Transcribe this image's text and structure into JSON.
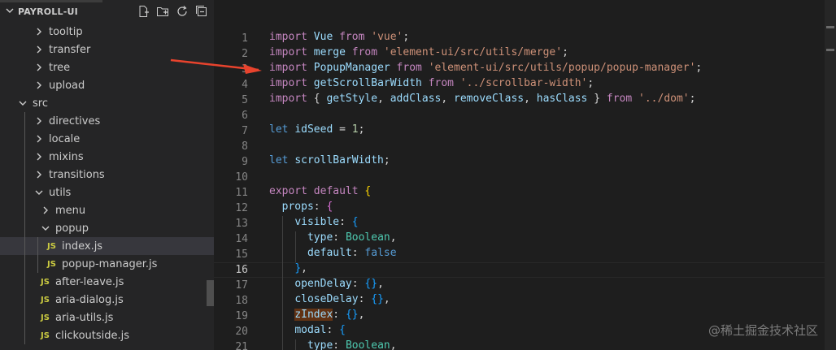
{
  "explorer": {
    "title": "PAYROLL-UI",
    "actions": [
      {
        "name": "new-file-icon"
      },
      {
        "name": "new-folder-icon"
      },
      {
        "name": "refresh-icon"
      },
      {
        "name": "collapse-all-icon"
      }
    ],
    "items": [
      {
        "label": "tooltip",
        "kind": "folder",
        "expanded": false,
        "depth": 2
      },
      {
        "label": "transfer",
        "kind": "folder",
        "expanded": false,
        "depth": 2
      },
      {
        "label": "tree",
        "kind": "folder",
        "expanded": false,
        "depth": 2
      },
      {
        "label": "upload",
        "kind": "folder",
        "expanded": false,
        "depth": 2
      },
      {
        "label": "src",
        "kind": "folder",
        "expanded": true,
        "depth": 1
      },
      {
        "label": "directives",
        "kind": "folder",
        "expanded": false,
        "depth": 2
      },
      {
        "label": "locale",
        "kind": "folder",
        "expanded": false,
        "depth": 2
      },
      {
        "label": "mixins",
        "kind": "folder",
        "expanded": false,
        "depth": 2
      },
      {
        "label": "transitions",
        "kind": "folder",
        "expanded": false,
        "depth": 2
      },
      {
        "label": "utils",
        "kind": "folder",
        "expanded": true,
        "depth": 2
      },
      {
        "label": "menu",
        "kind": "folder",
        "expanded": false,
        "depth": 3
      },
      {
        "label": "popup",
        "kind": "folder",
        "expanded": true,
        "depth": 3
      },
      {
        "label": "index.js",
        "kind": "file",
        "badge": "JS",
        "depth": 4,
        "selected": true
      },
      {
        "label": "popup-manager.js",
        "kind": "file",
        "badge": "JS",
        "depth": 4
      },
      {
        "label": "after-leave.js",
        "kind": "file",
        "badge": "JS",
        "depth": 3
      },
      {
        "label": "aria-dialog.js",
        "kind": "file",
        "badge": "JS",
        "depth": 3
      },
      {
        "label": "aria-utils.js",
        "kind": "file",
        "badge": "JS",
        "depth": 3
      },
      {
        "label": "clickoutside.js",
        "kind": "file",
        "badge": "JS",
        "depth": 3
      }
    ]
  },
  "editor": {
    "active_line": 16,
    "line_numbers": [
      "1",
      "2",
      "3",
      "4",
      "5",
      "6",
      "7",
      "8",
      "9",
      "10",
      "11",
      "12",
      "13",
      "14",
      "15",
      "16",
      "17",
      "18",
      "19",
      "20",
      "21"
    ],
    "lines": [
      [
        [
          "kw",
          "import"
        ],
        [
          "pu",
          " "
        ],
        [
          "vr",
          "Vue"
        ],
        [
          "pu",
          " "
        ],
        [
          "kw",
          "from"
        ],
        [
          "pu",
          " "
        ],
        [
          "st",
          "'vue'"
        ],
        [
          "pu",
          ";"
        ]
      ],
      [
        [
          "kw",
          "import"
        ],
        [
          "pu",
          " "
        ],
        [
          "vr",
          "merge"
        ],
        [
          "pu",
          " "
        ],
        [
          "kw",
          "from"
        ],
        [
          "pu",
          " "
        ],
        [
          "st",
          "'element-ui/src/utils/merge'"
        ],
        [
          "pu",
          ";"
        ]
      ],
      [
        [
          "kw",
          "import"
        ],
        [
          "pu",
          " "
        ],
        [
          "vr",
          "PopupManager"
        ],
        [
          "pu",
          " "
        ],
        [
          "kw",
          "from"
        ],
        [
          "pu",
          " "
        ],
        [
          "st",
          "'element-ui/src/utils/popup/popup-manager'"
        ],
        [
          "pu",
          ";"
        ]
      ],
      [
        [
          "kw",
          "import"
        ],
        [
          "pu",
          " "
        ],
        [
          "vr",
          "getScrollBarWidth"
        ],
        [
          "pu",
          " "
        ],
        [
          "kw",
          "from"
        ],
        [
          "pu",
          " "
        ],
        [
          "st",
          "'../scrollbar-width'"
        ],
        [
          "pu",
          ";"
        ]
      ],
      [
        [
          "kw",
          "import"
        ],
        [
          "pu",
          " { "
        ],
        [
          "vr",
          "getStyle"
        ],
        [
          "pu",
          ", "
        ],
        [
          "vr",
          "addClass"
        ],
        [
          "pu",
          ", "
        ],
        [
          "vr",
          "removeClass"
        ],
        [
          "pu",
          ", "
        ],
        [
          "vr",
          "hasClass"
        ],
        [
          "pu",
          " } "
        ],
        [
          "kw",
          "from"
        ],
        [
          "pu",
          " "
        ],
        [
          "st",
          "'../dom'"
        ],
        [
          "pu",
          ";"
        ]
      ],
      [],
      [
        [
          "bl",
          "let"
        ],
        [
          "pu",
          " "
        ],
        [
          "vr",
          "idSeed"
        ],
        [
          "pu",
          " = "
        ],
        [
          "num",
          "1"
        ],
        [
          "pu",
          ";"
        ]
      ],
      [],
      [
        [
          "bl",
          "let"
        ],
        [
          "pu",
          " "
        ],
        [
          "vr",
          "scrollBarWidth"
        ],
        [
          "pu",
          ";"
        ]
      ],
      [],
      [
        [
          "kw",
          "export"
        ],
        [
          "pu",
          " "
        ],
        [
          "kw",
          "default"
        ],
        [
          "pu",
          " "
        ],
        [
          "br1",
          "{"
        ]
      ],
      [
        [
          "pu",
          "  "
        ],
        [
          "vr",
          "props"
        ],
        [
          "pu",
          ": "
        ],
        [
          "br2",
          "{"
        ]
      ],
      [
        [
          "pu",
          "    "
        ],
        [
          "vr",
          "visible"
        ],
        [
          "pu",
          ": "
        ],
        [
          "br3",
          "{"
        ]
      ],
      [
        [
          "pu",
          "      "
        ],
        [
          "vr",
          "type"
        ],
        [
          "pu",
          ": "
        ],
        [
          "ty",
          "Boolean"
        ],
        [
          "pu",
          ","
        ]
      ],
      [
        [
          "pu",
          "      "
        ],
        [
          "vr",
          "default"
        ],
        [
          "pu",
          ": "
        ],
        [
          "bl",
          "false"
        ]
      ],
      [
        [
          "pu",
          "    "
        ],
        [
          "br3",
          "}"
        ],
        [
          "pu",
          ","
        ]
      ],
      [
        [
          "pu",
          "    "
        ],
        [
          "vr",
          "openDelay"
        ],
        [
          "pu",
          ": "
        ],
        [
          "br3",
          "{}"
        ],
        [
          "pu",
          ","
        ]
      ],
      [
        [
          "pu",
          "    "
        ],
        [
          "vr",
          "closeDelay"
        ],
        [
          "pu",
          ": "
        ],
        [
          "br3",
          "{}"
        ],
        [
          "pu",
          ","
        ]
      ],
      [
        [
          "pu",
          "    "
        ],
        [
          "hl",
          "zIndex"
        ],
        [
          "pu",
          ": "
        ],
        [
          "br3",
          "{}"
        ],
        [
          "pu",
          ","
        ]
      ],
      [
        [
          "pu",
          "    "
        ],
        [
          "vr",
          "modal"
        ],
        [
          "pu",
          ": "
        ],
        [
          "br3",
          "{"
        ]
      ],
      [
        [
          "pu",
          "      "
        ],
        [
          "vr",
          "type"
        ],
        [
          "pu",
          ": "
        ],
        [
          "ty",
          "Boolean"
        ],
        [
          "pu",
          ","
        ]
      ]
    ]
  },
  "annotation": {
    "arrow_color": "#e8432d"
  },
  "watermark": "@稀土掘金技术社区",
  "colors": {
    "sidebar_bg": "#252526",
    "editor_bg": "#1e1e1e",
    "selection": "#37373d",
    "js_badge": "#cbcb41"
  }
}
